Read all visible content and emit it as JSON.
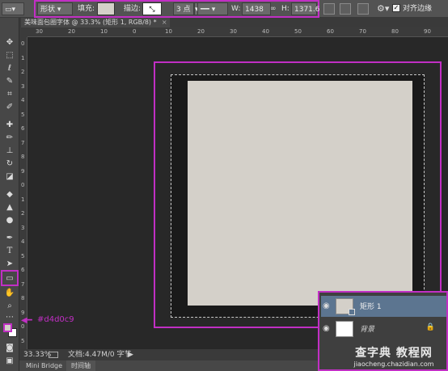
{
  "options": {
    "mode": "形状",
    "fill_label": "填充:",
    "stroke_label": "描边:",
    "stroke_size": "3 点",
    "w_label": "W:",
    "w_value": "1438 像",
    "h_label": "H:",
    "h_value": "1371.6",
    "align_edges_label": "对齐边缘"
  },
  "document": {
    "tab_title": "美味面包圈字体 @ 33.3% (矩形 1, RGB/8) *",
    "close": "×"
  },
  "rulers": {
    "h_ticks": [
      "30",
      "20",
      "10",
      "0",
      "10",
      "20",
      "30",
      "40",
      "50",
      "60",
      "70",
      "80",
      "90"
    ],
    "v_ticks": [
      "0",
      "1",
      "2",
      "3",
      "4",
      "5",
      "6",
      "7",
      "8",
      "9",
      "0",
      "1",
      "2",
      "3",
      "4",
      "5",
      "6",
      "7",
      "8",
      "9",
      "0",
      "5"
    ]
  },
  "annotation": {
    "color_code": "#d4d0c9"
  },
  "status": {
    "zoom": "33.33%",
    "doc_info": "文档:4.47M/0 字节"
  },
  "bottom_tabs": [
    "Mini Bridge",
    "时间轴"
  ],
  "layers": [
    {
      "name": "矩形 1",
      "selected": true
    },
    {
      "name": "背景",
      "selected": false,
      "locked": true
    }
  ],
  "watermark": {
    "line1": "查字典 教程网",
    "line2": "jiaocheng.chazidian.com"
  },
  "colors": {
    "rect_fill": "#d4d0c9",
    "highlight": "#c12fc4"
  }
}
